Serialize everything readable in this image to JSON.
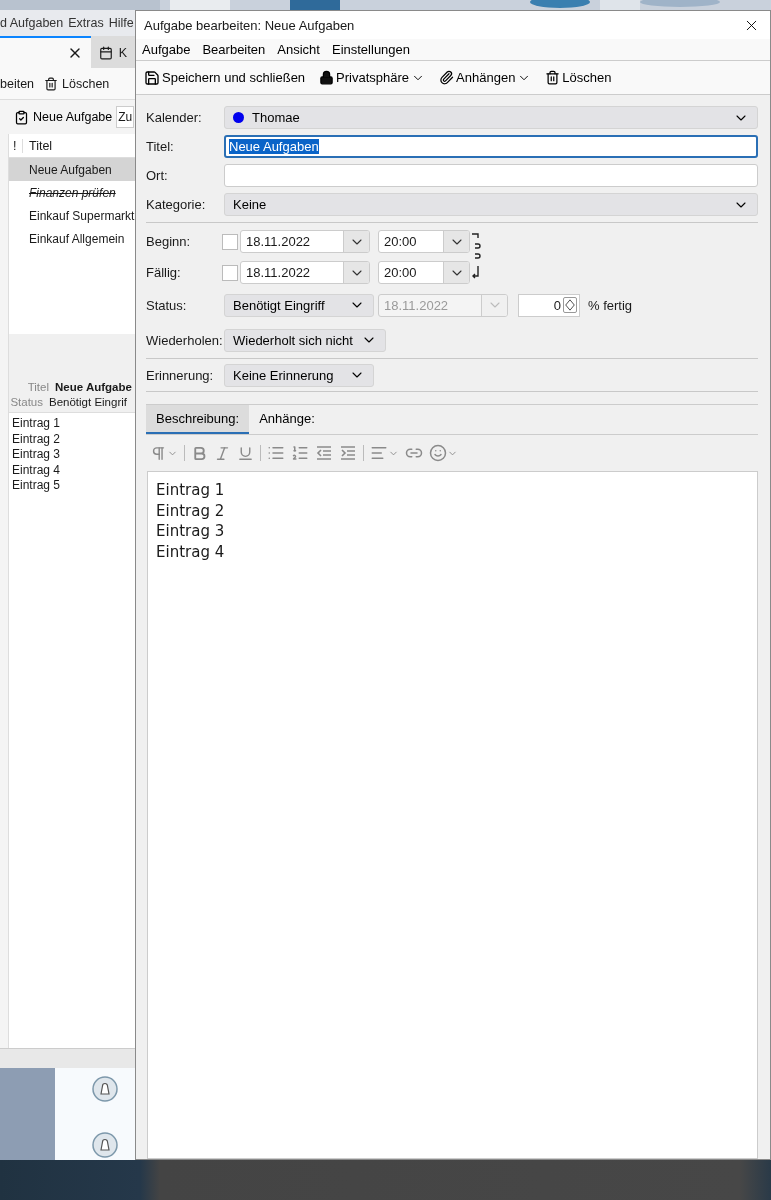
{
  "background_window": {
    "menu": [
      "d Aufgaben",
      "Extras",
      "Hilfe"
    ],
    "tabs": [
      {
        "selected": true
      },
      {
        "label": "K",
        "selected": false
      }
    ],
    "toolbar": [
      {
        "kind": "text",
        "label": "beiten"
      },
      {
        "kind": "delete",
        "label": "Löschen"
      }
    ],
    "new_task_button": "Neue Aufgabe",
    "filter_field": "Zu",
    "task_list": {
      "columns": [
        "!",
        "Titel"
      ],
      "rows": [
        {
          "title": "Neue Aufgaben",
          "selected": true,
          "completed": false
        },
        {
          "title": "Finanzen prüfen",
          "selected": false,
          "completed": true
        },
        {
          "title": "Einkauf Supermarkt",
          "selected": false,
          "completed": false
        },
        {
          "title": "Einkauf Allgemein",
          "selected": false,
          "completed": false
        }
      ]
    },
    "details": {
      "fields": [
        {
          "label": "Titel",
          "value": "Neue Aufgabe"
        },
        {
          "label": "Status",
          "value": "Benötigt Eingrif"
        }
      ],
      "description": [
        "Eintrag 1",
        "Eintrag 2",
        "Eintrag 3",
        "Eintrag 4",
        "Eintrag 5"
      ]
    }
  },
  "dialog": {
    "title": "Aufgabe bearbeiten: Neue Aufgaben",
    "menu": [
      "Aufgabe",
      "Bearbeiten",
      "Ansicht",
      "Einstellungen"
    ],
    "toolbar": [
      {
        "kind": "save",
        "label": "Speichern und schließen",
        "menu": false
      },
      {
        "kind": "privacy",
        "label": "Privatsphäre",
        "menu": true
      },
      {
        "kind": "attach",
        "label": "Anhängen",
        "menu": true
      },
      {
        "kind": "delete",
        "label": "Löschen",
        "menu": false
      }
    ],
    "calendar": {
      "label": "Kalender:",
      "value": "Thomae",
      "color": "#0000ee"
    },
    "title_field": {
      "label": "Titel:",
      "value": "Neue Aufgaben",
      "text_selected": true
    },
    "location": {
      "label": "Ort:"
    },
    "category": {
      "label": "Kategorie:",
      "value": "Keine"
    },
    "dates": [
      {
        "label": "Beginn:",
        "checked": false,
        "date": "18.11.2022",
        "time": "20:00"
      },
      {
        "label": "Fällig:",
        "checked": false,
        "date": "18.11.2022",
        "time": "20:00"
      }
    ],
    "status": {
      "label": "Status:",
      "value": "Benötigt Eingriff",
      "completed_date": "18.11.2022",
      "completed_date_disabled": true,
      "percent": "0",
      "percent_label": "% fertig"
    },
    "repeat": {
      "label": "Wiederholen:",
      "value": "Wiederholt sich nicht"
    },
    "reminder": {
      "label": "Erinnerung:",
      "value": "Keine Erinnerung"
    },
    "tabs": [
      {
        "label": "Beschreibung:",
        "selected": true
      },
      {
        "label": "Anhänge:",
        "selected": false
      }
    ],
    "description": [
      "Eintrag 1",
      "Eintrag 2",
      "Eintrag 3",
      "Eintrag 4"
    ]
  }
}
